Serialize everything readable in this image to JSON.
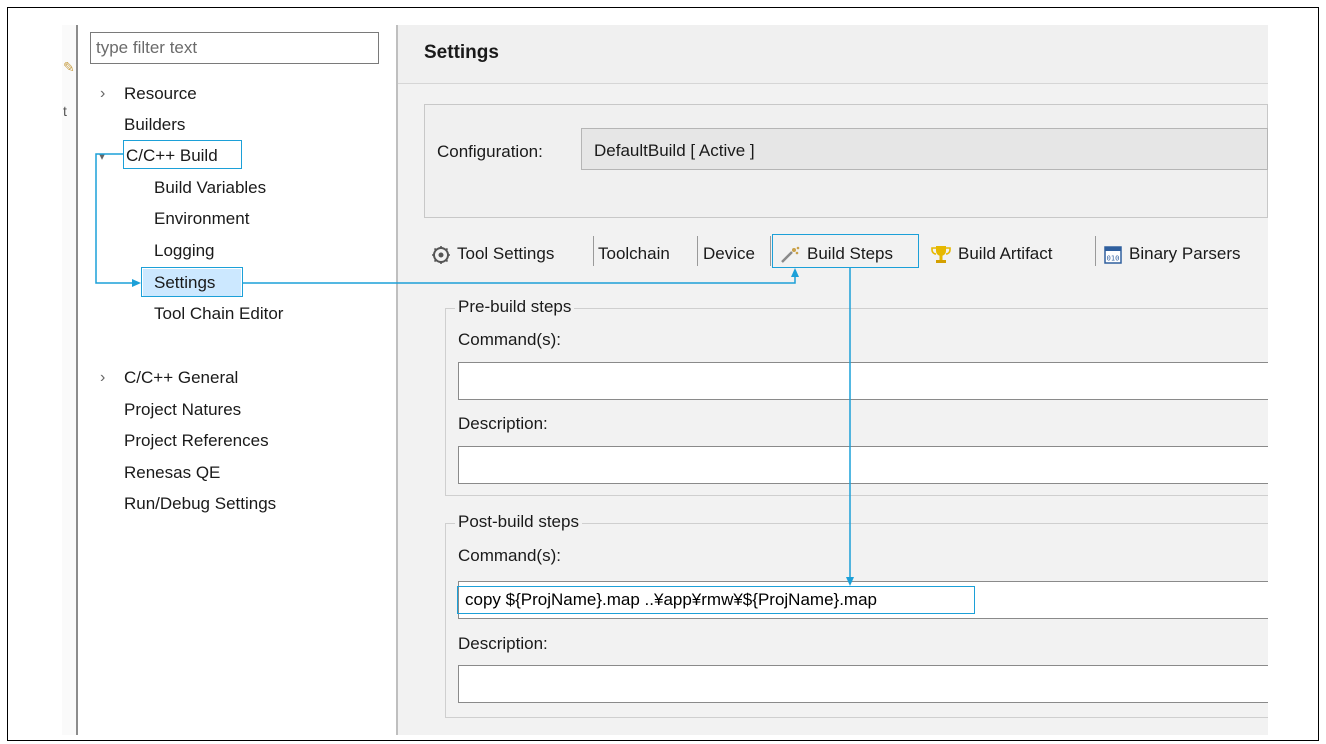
{
  "filter": {
    "placeholder": "type filter text"
  },
  "tree": {
    "resource": "Resource",
    "builders": "Builders",
    "cc_build": "C/C++ Build",
    "build_variables": "Build Variables",
    "environment": "Environment",
    "logging": "Logging",
    "settings": "Settings",
    "tool_chain_editor": "Tool Chain Editor",
    "cc_general": "C/C++ General",
    "project_natures": "Project Natures",
    "project_references": "Project References",
    "renesas_qe": "Renesas QE",
    "run_debug_settings": "Run/Debug Settings"
  },
  "page": {
    "title": "Settings"
  },
  "config": {
    "label": "Configuration:",
    "value": "DefaultBuild  [ Active ]"
  },
  "tabs": {
    "tool_settings": "Tool Settings",
    "toolchain": "Toolchain",
    "device": "Device",
    "build_steps": "Build Steps",
    "build_artifact": "Build Artifact",
    "binary_parsers": "Binary Parsers"
  },
  "pre_build": {
    "title": "Pre-build steps",
    "command_label": "Command(s):",
    "command_value": "",
    "description_label": "Description:",
    "description_value": ""
  },
  "post_build": {
    "title": "Post-build steps",
    "command_label": "Command(s):",
    "command_value": "copy ${ProjName}.map ..¥app¥rmw¥${ProjName}.map",
    "description_label": "Description:",
    "description_value": ""
  },
  "colors": {
    "callout": "#1ca0d8"
  }
}
